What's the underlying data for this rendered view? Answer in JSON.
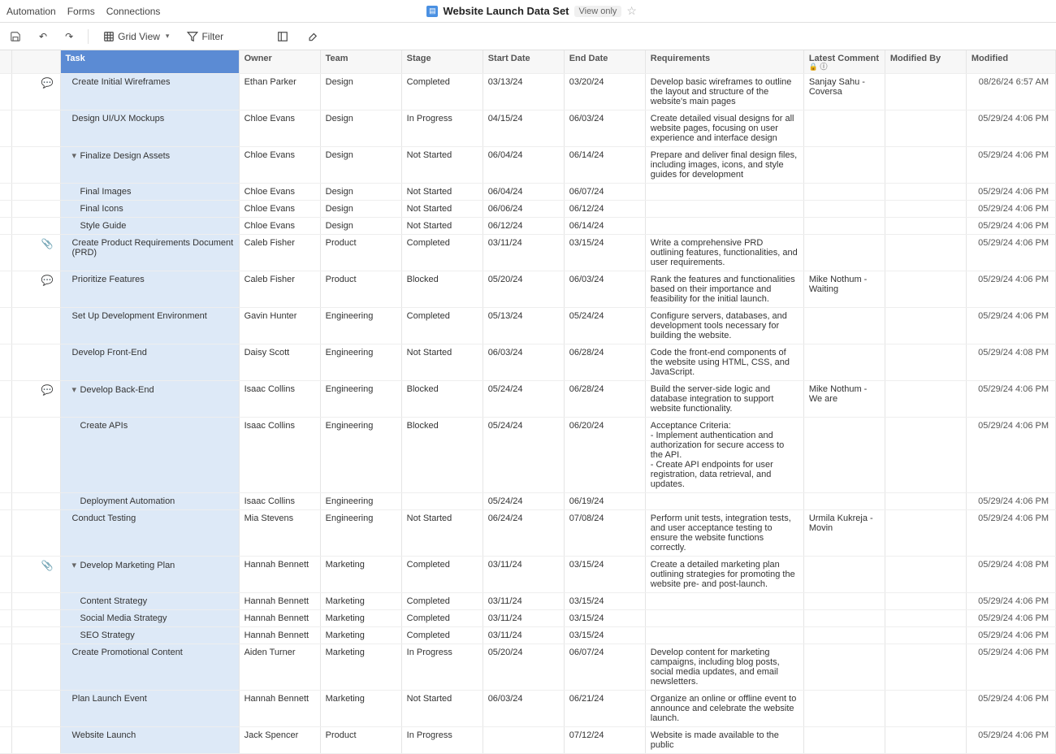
{
  "menu": {
    "automation": "Automation",
    "forms": "Forms",
    "connections": "Connections"
  },
  "header": {
    "title": "Website Launch Data Set",
    "view_badge": "View only"
  },
  "toolbar": {
    "grid_view": "Grid View",
    "filter": "Filter"
  },
  "columns": {
    "task": "Task",
    "owner": "Owner",
    "team": "Team",
    "stage": "Stage",
    "start": "Start Date",
    "end": "End Date",
    "requirements": "Requirements",
    "latest_comment": "Latest Comment",
    "modified_by": "Modified By",
    "modified": "Modified"
  },
  "rows": [
    {
      "indent": 1,
      "icons": "💬",
      "task": "Create Initial Wireframes",
      "owner": "Ethan Parker",
      "team": "Design",
      "stage": "Completed",
      "start": "03/13/24",
      "end": "03/20/24",
      "req": "Develop basic wireframes to outline the layout and structure of the website's main pages",
      "comment": "Sanjay Sahu - Coversa",
      "modby": "",
      "mod": "08/26/24 6:57 AM"
    },
    {
      "indent": 1,
      "icons": "",
      "task": "Design UI/UX Mockups",
      "owner": "Chloe Evans",
      "team": "Design",
      "stage": "In Progress",
      "start": "04/15/24",
      "end": "06/03/24",
      "req": "Create detailed visual designs for all website pages, focusing on user experience and interface design",
      "comment": "",
      "modby": "",
      "mod": "05/29/24 4:06 PM"
    },
    {
      "indent": 1,
      "expander": "▾",
      "icons": "",
      "task": "Finalize Design Assets",
      "owner": "Chloe Evans",
      "team": "Design",
      "stage": "Not Started",
      "start": "06/04/24",
      "end": "06/14/24",
      "req": "Prepare and deliver final design files, including images, icons, and style guides for development",
      "comment": "",
      "modby": "",
      "mod": "05/29/24 4:06 PM"
    },
    {
      "indent": 2,
      "icons": "",
      "task": "Final Images",
      "owner": "Chloe Evans",
      "team": "Design",
      "stage": "Not Started",
      "start": "06/04/24",
      "end": "06/07/24",
      "req": "",
      "comment": "",
      "modby": "",
      "mod": "05/29/24 4:06 PM"
    },
    {
      "indent": 2,
      "icons": "",
      "task": "Final Icons",
      "owner": "Chloe Evans",
      "team": "Design",
      "stage": "Not Started",
      "start": "06/06/24",
      "end": "06/12/24",
      "req": "",
      "comment": "",
      "modby": "",
      "mod": "05/29/24 4:06 PM"
    },
    {
      "indent": 2,
      "icons": "",
      "task": "Style Guide",
      "owner": "Chloe Evans",
      "team": "Design",
      "stage": "Not Started",
      "start": "06/12/24",
      "end": "06/14/24",
      "req": "",
      "comment": "",
      "modby": "",
      "mod": "05/29/24 4:06 PM"
    },
    {
      "indent": 1,
      "icons": "📎",
      "task": "Create Product Requirements Document (PRD)",
      "owner": "Caleb Fisher",
      "team": "Product",
      "stage": "Completed",
      "start": "03/11/24",
      "end": "03/15/24",
      "req": "Write a comprehensive PRD outlining features, functionalities, and user requirements.",
      "comment": "",
      "modby": "",
      "mod": "05/29/24 4:06 PM"
    },
    {
      "indent": 1,
      "icons": "💬",
      "task": "Prioritize Features",
      "owner": "Caleb Fisher",
      "team": "Product",
      "stage": "Blocked",
      "start": "05/20/24",
      "end": "06/03/24",
      "req": "Rank the features and functionalities based on their importance and feasibility for the initial launch.",
      "comment": "Mike Nothum - Waiting",
      "modby": "",
      "mod": "05/29/24 4:06 PM"
    },
    {
      "indent": 1,
      "icons": "",
      "task": "Set Up Development Environment",
      "owner": "Gavin Hunter",
      "team": "Engineering",
      "stage": "Completed",
      "start": "05/13/24",
      "end": "05/24/24",
      "req": "Configure servers, databases, and development tools necessary for building the website.",
      "comment": "",
      "modby": "",
      "mod": "05/29/24 4:06 PM"
    },
    {
      "indent": 1,
      "icons": "",
      "task": "Develop Front-End",
      "owner": "Daisy Scott",
      "team": "Engineering",
      "stage": "Not Started",
      "start": "06/03/24",
      "end": "06/28/24",
      "req": "Code the front-end components of the website using HTML, CSS, and JavaScript.",
      "comment": "",
      "modby": "",
      "mod": "05/29/24 4:08 PM"
    },
    {
      "indent": 1,
      "expander": "▾",
      "icons": "💬",
      "task": "Develop Back-End",
      "owner": "Isaac Collins",
      "team": "Engineering",
      "stage": "Blocked",
      "start": "05/24/24",
      "end": "06/28/24",
      "req": "Build the server-side logic and database integration to support website functionality.",
      "comment": "Mike Nothum - We are",
      "modby": "",
      "mod": "05/29/24 4:06 PM"
    },
    {
      "indent": 2,
      "icons": "",
      "task": "Create APIs",
      "owner": "Isaac Collins",
      "team": "Engineering",
      "stage": "Blocked",
      "start": "05/24/24",
      "end": "06/20/24",
      "req": "Acceptance Criteria:\n- Implement authentication and authorization for secure access to the API.\n- Create API endpoints for user registration, data retrieval, and updates.",
      "comment": "",
      "modby": "",
      "mod": "05/29/24 4:06 PM"
    },
    {
      "indent": 2,
      "icons": "",
      "task": "Deployment Automation",
      "owner": "Isaac Collins",
      "team": "Engineering",
      "stage": "",
      "start": "05/24/24",
      "end": "06/19/24",
      "req": "",
      "comment": "",
      "modby": "",
      "mod": "05/29/24 4:06 PM"
    },
    {
      "indent": 1,
      "icons": "",
      "task": "Conduct Testing",
      "owner": "Mia Stevens",
      "team": "Engineering",
      "stage": "Not Started",
      "start": "06/24/24",
      "end": "07/08/24",
      "req": "Perform unit tests, integration tests, and user acceptance testing to ensure the website functions correctly.",
      "comment": "Urmila Kukreja - Movin",
      "modby": "",
      "mod": "05/29/24 4:06 PM"
    },
    {
      "indent": 1,
      "expander": "▾",
      "icons": "📎",
      "task": "Develop Marketing Plan",
      "owner": "Hannah Bennett",
      "team": "Marketing",
      "stage": "Completed",
      "start": "03/11/24",
      "end": "03/15/24",
      "req": "Create a detailed marketing plan outlining strategies for promoting the website pre- and post-launch.",
      "comment": "",
      "modby": "",
      "mod": "05/29/24 4:08 PM"
    },
    {
      "indent": 2,
      "icons": "",
      "task": "Content Strategy",
      "owner": "Hannah Bennett",
      "team": "Marketing",
      "stage": "Completed",
      "start": "03/11/24",
      "end": "03/15/24",
      "req": "",
      "comment": "",
      "modby": "",
      "mod": "05/29/24 4:06 PM"
    },
    {
      "indent": 2,
      "icons": "",
      "task": "Social Media Strategy",
      "owner": "Hannah Bennett",
      "team": "Marketing",
      "stage": "Completed",
      "start": "03/11/24",
      "end": "03/15/24",
      "req": "",
      "comment": "",
      "modby": "",
      "mod": "05/29/24 4:06 PM"
    },
    {
      "indent": 2,
      "icons": "",
      "task": "SEO Strategy",
      "owner": "Hannah Bennett",
      "team": "Marketing",
      "stage": "Completed",
      "start": "03/11/24",
      "end": "03/15/24",
      "req": "",
      "comment": "",
      "modby": "",
      "mod": "05/29/24 4:06 PM"
    },
    {
      "indent": 1,
      "icons": "",
      "task": "Create Promotional Content",
      "owner": "Aiden Turner",
      "team": "Marketing",
      "stage": "In Progress",
      "start": "05/20/24",
      "end": "06/07/24",
      "req": "Develop content for marketing campaigns, including blog posts, social media updates, and email newsletters.",
      "comment": "",
      "modby": "",
      "mod": "05/29/24 4:06 PM"
    },
    {
      "indent": 1,
      "icons": "",
      "task": "Plan Launch Event",
      "owner": "Hannah Bennett",
      "team": "Marketing",
      "stage": "Not Started",
      "start": "06/03/24",
      "end": "06/21/24",
      "req": "Organize an online or offline event to announce and celebrate the website launch.",
      "comment": "",
      "modby": "",
      "mod": "05/29/24 4:06 PM"
    },
    {
      "indent": 1,
      "icons": "",
      "task": "Website Launch",
      "owner": "Jack Spencer",
      "team": "Product",
      "stage": "In Progress",
      "start": "",
      "end": "07/12/24",
      "req": "Website is made available to the public",
      "comment": "",
      "modby": "",
      "mod": "05/29/24 4:06 PM"
    }
  ]
}
